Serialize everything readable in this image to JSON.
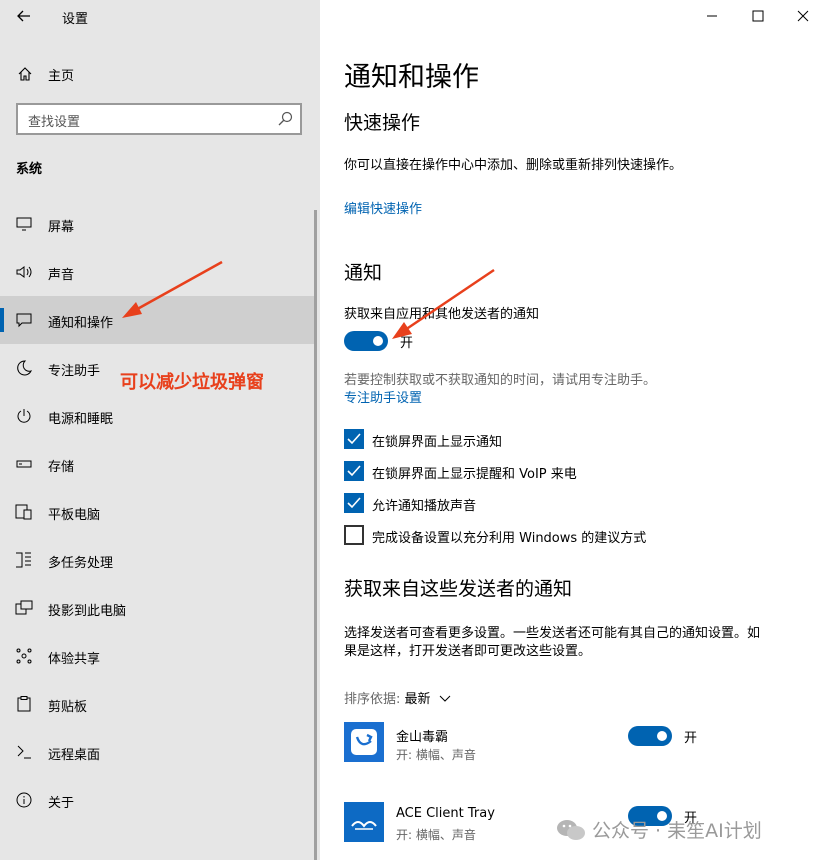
{
  "window": {
    "title": "设置"
  },
  "sidebar": {
    "home_label": "主页",
    "search_placeholder": "查找设置",
    "section": "系统",
    "items": [
      {
        "label": "屏幕",
        "icon": "monitor-icon"
      },
      {
        "label": "声音",
        "icon": "speaker-icon"
      },
      {
        "label": "通知和操作",
        "icon": "notification-icon",
        "selected": true
      },
      {
        "label": "专注助手",
        "icon": "moon-icon"
      },
      {
        "label": "电源和睡眠",
        "icon": "power-icon"
      },
      {
        "label": "存储",
        "icon": "storage-icon"
      },
      {
        "label": "平板电脑",
        "icon": "tablet-icon"
      },
      {
        "label": "多任务处理",
        "icon": "multitask-icon"
      },
      {
        "label": "投影到此电脑",
        "icon": "project-icon"
      },
      {
        "label": "体验共享",
        "icon": "share-icon"
      },
      {
        "label": "剪贴板",
        "icon": "clipboard-icon"
      },
      {
        "label": "远程桌面",
        "icon": "remote-desktop-icon"
      },
      {
        "label": "关于",
        "icon": "info-icon"
      }
    ]
  },
  "annotation": {
    "text": "可以减少垃圾弹窗",
    "color": "#e8401c"
  },
  "main": {
    "title": "通知和操作",
    "quick_actions": {
      "heading": "快速操作",
      "desc": "你可以直接在操作中心中添加、删除或重新排列快速操作。",
      "link": "编辑快速操作"
    },
    "notifications": {
      "heading": "通知",
      "toggle_label_text": "获取来自应用和其他发送者的通知",
      "toggle_state": "开",
      "focus_hint": "若要控制获取或不获取通知的时间，请试用专注助手。",
      "focus_link": "专注助手设置",
      "checkboxes": [
        {
          "label": "在锁屏界面上显示通知",
          "checked": true
        },
        {
          "label": "在锁屏界面上显示提醒和 VoIP 来电",
          "checked": true
        },
        {
          "label": "允许通知播放声音",
          "checked": true
        },
        {
          "label": "完成设备设置以充分利用 Windows 的建议方式",
          "checked": false
        }
      ]
    },
    "senders": {
      "heading": "获取来自这些发送者的通知",
      "desc_line1": "选择发送者可查看更多设置。一些发送者还可能有其自己的通知设置。如",
      "desc_line2": "果是这样，打开发送者即可更改这些设置。",
      "sort_label": "排序依据:",
      "sort_value": "最新",
      "apps": [
        {
          "name": "金山毒霸",
          "sub": "开: 横幅、声音",
          "state": "开"
        },
        {
          "name": "ACE Client Tray",
          "sub": "开: 横幅、声音",
          "state": "开"
        }
      ]
    }
  },
  "watermark": "公众号 · 耒笙AI计划",
  "colors": {
    "accent": "#0063b1",
    "sidebar_bg": "#e6e6e6",
    "annotation": "#e8401c"
  }
}
